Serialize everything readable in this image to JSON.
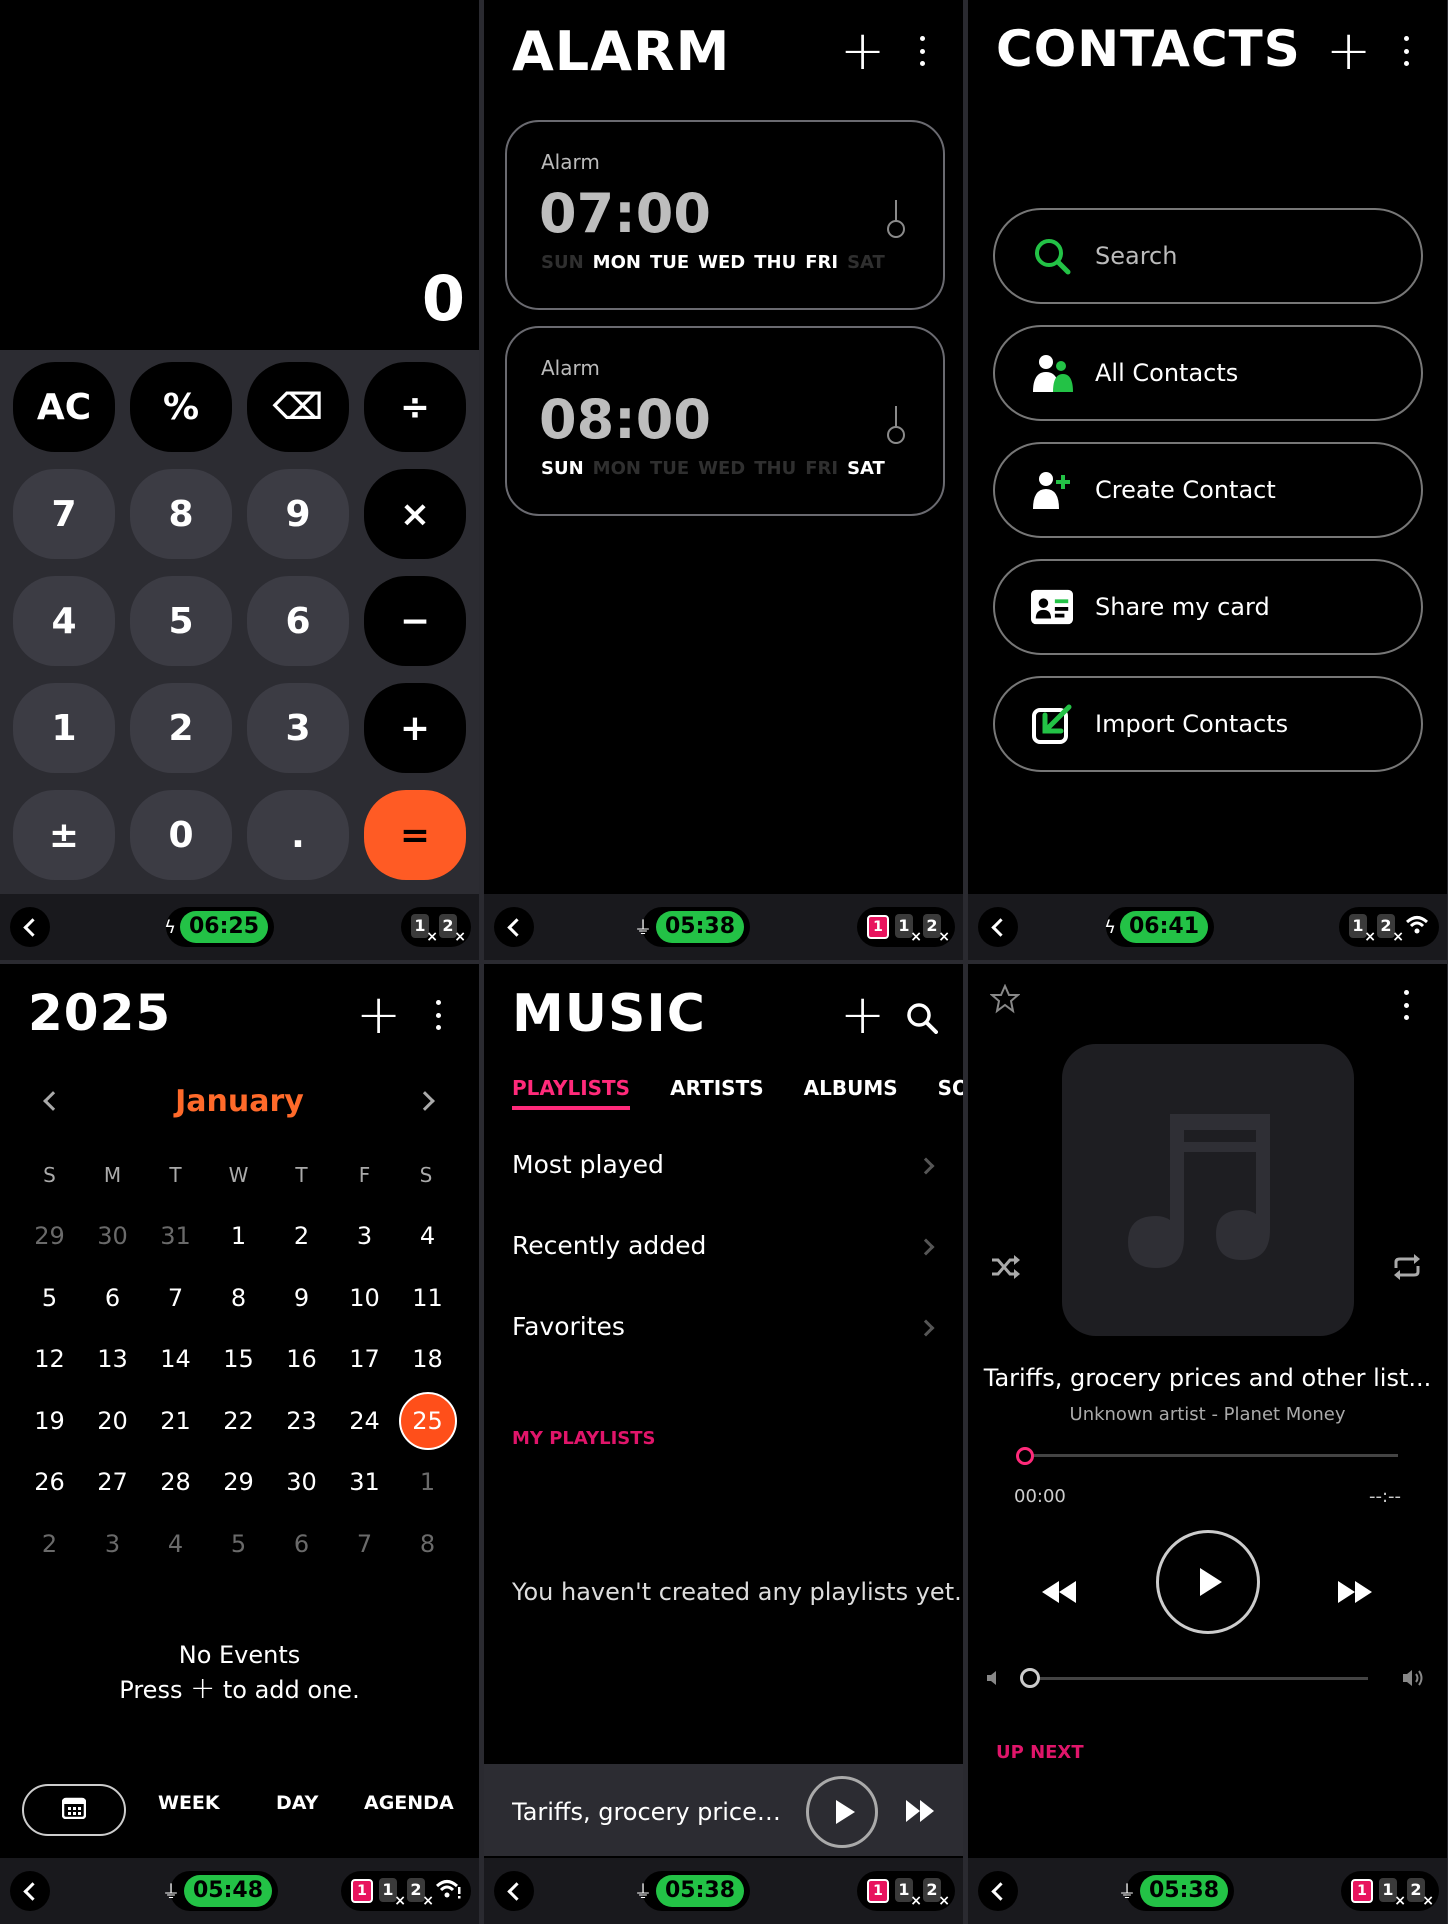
{
  "calculator": {
    "display": "0",
    "keys": [
      "AC",
      "%",
      "⌫",
      "÷",
      "7",
      "8",
      "9",
      "×",
      "4",
      "5",
      "6",
      "−",
      "1",
      "2",
      "3",
      "+",
      "±",
      "0",
      ".",
      "="
    ],
    "status_time": "06:25"
  },
  "alarm": {
    "title": "ALARM",
    "alarms": [
      {
        "label": "Alarm",
        "time": "07:00",
        "days": [
          "SUN",
          "MON",
          "TUE",
          "WED",
          "THU",
          "FRI",
          "SAT"
        ],
        "active": [
          false,
          true,
          true,
          true,
          true,
          true,
          false
        ]
      },
      {
        "label": "Alarm",
        "time": "08:00",
        "days": [
          "SUN",
          "MON",
          "TUE",
          "WED",
          "THU",
          "FRI",
          "SAT"
        ],
        "active": [
          true,
          false,
          false,
          false,
          false,
          false,
          true
        ]
      }
    ],
    "status_time": "05:38"
  },
  "contacts": {
    "title": "CONTACTS",
    "search_placeholder": "Search",
    "items": [
      "All Contacts",
      "Create Contact",
      "Share my card",
      "Import Contacts"
    ],
    "status_time": "06:41"
  },
  "calendar": {
    "year": "2025",
    "month": "January",
    "weekdays": [
      "S",
      "M",
      "T",
      "W",
      "T",
      "F",
      "S"
    ],
    "weeks": [
      [
        "29",
        "30",
        "31",
        "1",
        "2",
        "3",
        "4"
      ],
      [
        "5",
        "6",
        "7",
        "8",
        "9",
        "10",
        "11"
      ],
      [
        "12",
        "13",
        "14",
        "15",
        "16",
        "17",
        "18"
      ],
      [
        "19",
        "20",
        "21",
        "22",
        "23",
        "24",
        "25"
      ],
      [
        "26",
        "27",
        "28",
        "29",
        "30",
        "31",
        "1"
      ],
      [
        "2",
        "3",
        "4",
        "5",
        "6",
        "7",
        "8"
      ]
    ],
    "today": "25",
    "no_events": "No Events",
    "press_add_pre": "Press",
    "press_add_post": "to add one.",
    "tabs": [
      "WEEK",
      "DAY",
      "AGENDA"
    ],
    "status_time": "05:48"
  },
  "music": {
    "title": "MUSIC",
    "tabs": [
      "PLAYLISTS",
      "ARTISTS",
      "ALBUMS",
      "SONGS"
    ],
    "playlists": [
      "Most played",
      "Recently added",
      "Favorites"
    ],
    "my_playlists": "MY PLAYLISTS",
    "empty": "You haven't created any playlists yet.",
    "mini_title": "Tariffs, grocery prices ...",
    "status_time": "05:38"
  },
  "player": {
    "title": "Tariffs, grocery prices and other list...",
    "subtitle": "Unknown artist - Planet Money",
    "elapsed": "00:00",
    "remaining": "--:--",
    "progress": 0,
    "volume": 0,
    "up_next": "UP NEXT",
    "status_time": "05:38"
  },
  "colors": {
    "accent_green": "#23c246",
    "calc_equals": "#ff5b24",
    "calendar_accent": "#ff4f1a",
    "music_accent": "#ff2a7a",
    "contacts_accent": "#23c246"
  }
}
